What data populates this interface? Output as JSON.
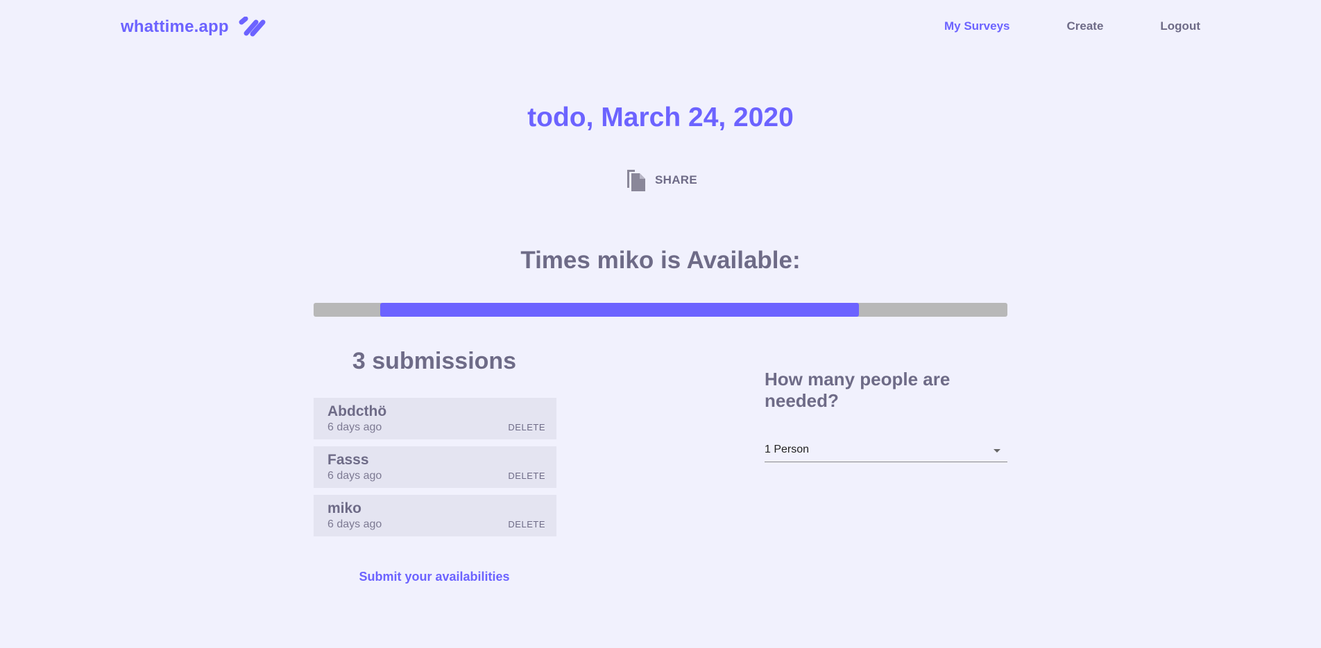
{
  "header": {
    "brand": "whattime.app",
    "nav": [
      "My Surveys",
      "Create",
      "Logout"
    ],
    "active_nav": "My Surveys"
  },
  "main": {
    "title": "todo, March 24, 2020",
    "share_label": "SHARE",
    "availability_heading": "Times miko is Available:",
    "availability_range": {
      "start_fraction": 0.096,
      "end_fraction": 0.786
    },
    "submissions_heading": "3 submissions",
    "submissions": [
      {
        "name": "Abdcthö",
        "time": "6 days ago",
        "action": "DELETE"
      },
      {
        "name": "Fasss",
        "time": "6 days ago",
        "action": "DELETE"
      },
      {
        "name": "miko",
        "time": "6 days ago",
        "action": "DELETE"
      }
    ],
    "submit_link": "Submit your availabilities",
    "people_heading": "How many people are needed?",
    "people_select_value": "1 Person"
  },
  "colors": {
    "accent": "#6c63ff",
    "background": "#f1f1fd",
    "text": "#6e6b87",
    "track": "#b8b8b8",
    "list_item": "#e4e4f1"
  },
  "icons": {
    "brand_logo": "double-slash-logo",
    "share": "copy-file-icon",
    "select_arrow": "caret-down-icon"
  }
}
